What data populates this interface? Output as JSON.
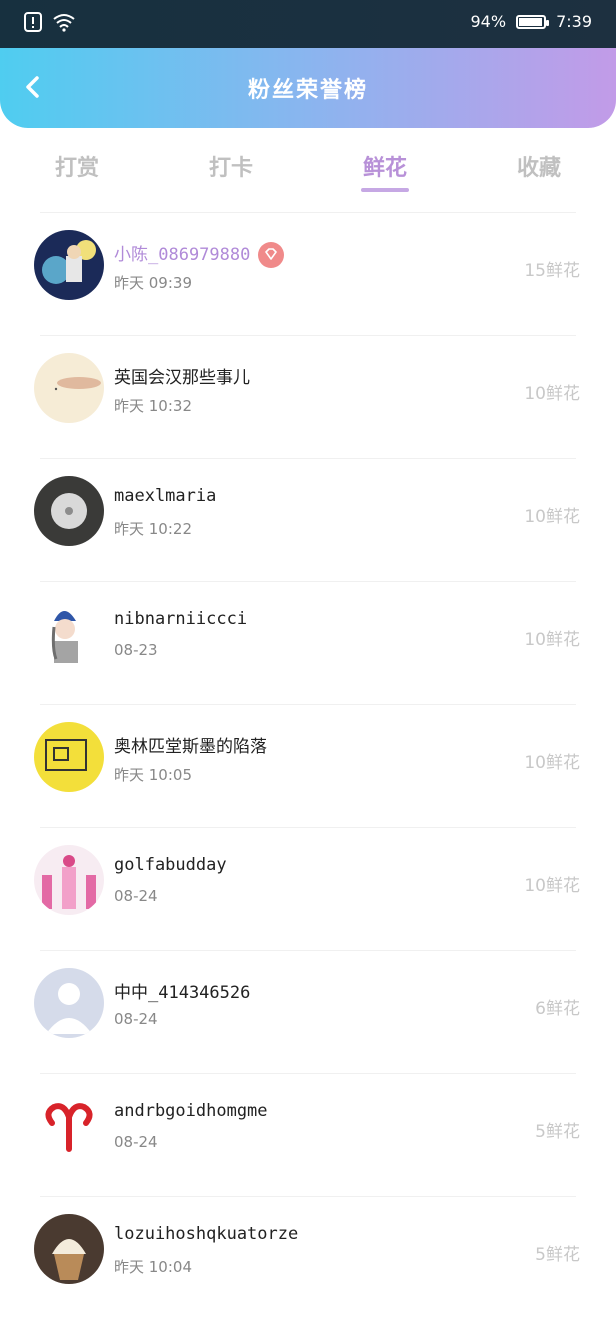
{
  "status_bar": {
    "battery": "94%",
    "time": "7:39",
    "battery_level": 0.94
  },
  "header": {
    "title": "粉丝荣誉榜"
  },
  "tabs": [
    {
      "label": "打赏"
    },
    {
      "label": "打卡"
    },
    {
      "label": "鲜花"
    },
    {
      "label": "收藏"
    }
  ],
  "active_tab": 2,
  "rows": [
    {
      "name": "小陈_086979880",
      "time": "昨天 09:39",
      "count": "15鲜花",
      "vip": true,
      "avatar": "space-avatar"
    },
    {
      "name": "英国会汉那些事儿",
      "time": "昨天 10:32",
      "count": "10鲜花",
      "avatar": "cream-avatar"
    },
    {
      "name": "maexlmaria",
      "time": "昨天 10:22",
      "count": "10鲜花",
      "avatar": "dandelion-avatar"
    },
    {
      "name": "nibnarniiccci",
      "time": "08-23",
      "count": "10鲜花",
      "avatar": "anime-girl-avatar"
    },
    {
      "name": "奥林匹堂斯墨的陷落",
      "time": "昨天 10:05",
      "count": "10鲜花",
      "avatar": "yellow-drawing-avatar"
    },
    {
      "name": "golfabudday",
      "time": "08-24",
      "count": "10鲜花",
      "avatar": "pink-scene-avatar"
    },
    {
      "name": "中中_414346526",
      "time": "08-24",
      "count": "6鲜花",
      "avatar": "default-person-avatar"
    },
    {
      "name": "andrbgoidhomgme",
      "time": "08-24",
      "count": "5鲜花",
      "avatar": "aries-symbol-avatar"
    },
    {
      "name": "lozuihoshqkuatorze",
      "time": "昨天 10:04",
      "count": "5鲜花",
      "avatar": "cupcake-avatar"
    }
  ]
}
